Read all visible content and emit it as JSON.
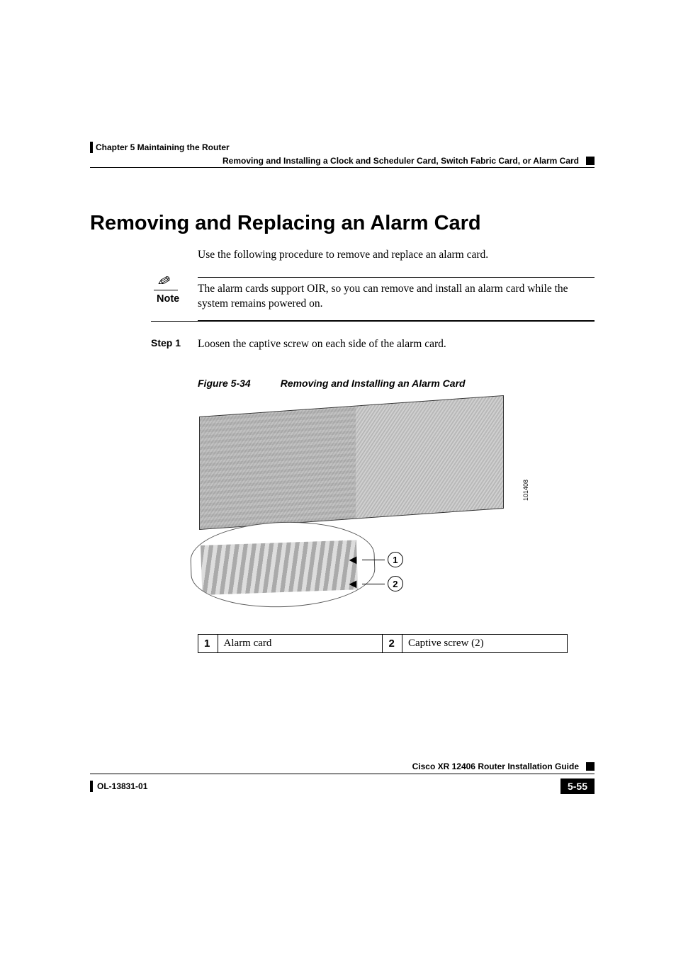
{
  "header": {
    "chapter": "Chapter 5    Maintaining the Router",
    "section": "Removing and Installing a Clock and Scheduler Card, Switch Fabric Card, or Alarm Card"
  },
  "heading": "Removing and Replacing an Alarm Card",
  "intro": "Use the following procedure to remove and replace an alarm card.",
  "note": {
    "label": "Note",
    "text": "The alarm cards support OIR, so you can remove and install an alarm card while the system remains powered on."
  },
  "steps": [
    {
      "label": "Step 1",
      "text": "Loosen the captive screw on each side of the alarm card."
    }
  ],
  "figure": {
    "refLabel": "Figure 5-34",
    "title": "Removing and Installing an Alarm Card",
    "callouts": [
      "1",
      "2"
    ],
    "image_id": "101408"
  },
  "legend": {
    "items": [
      {
        "num": "1",
        "text": "Alarm card"
      },
      {
        "num": "2",
        "text": "Captive screw (2)"
      }
    ]
  },
  "footer": {
    "guide": "Cisco XR 12406 Router Installation Guide",
    "docid": "OL-13831-01",
    "page": "5-55"
  }
}
